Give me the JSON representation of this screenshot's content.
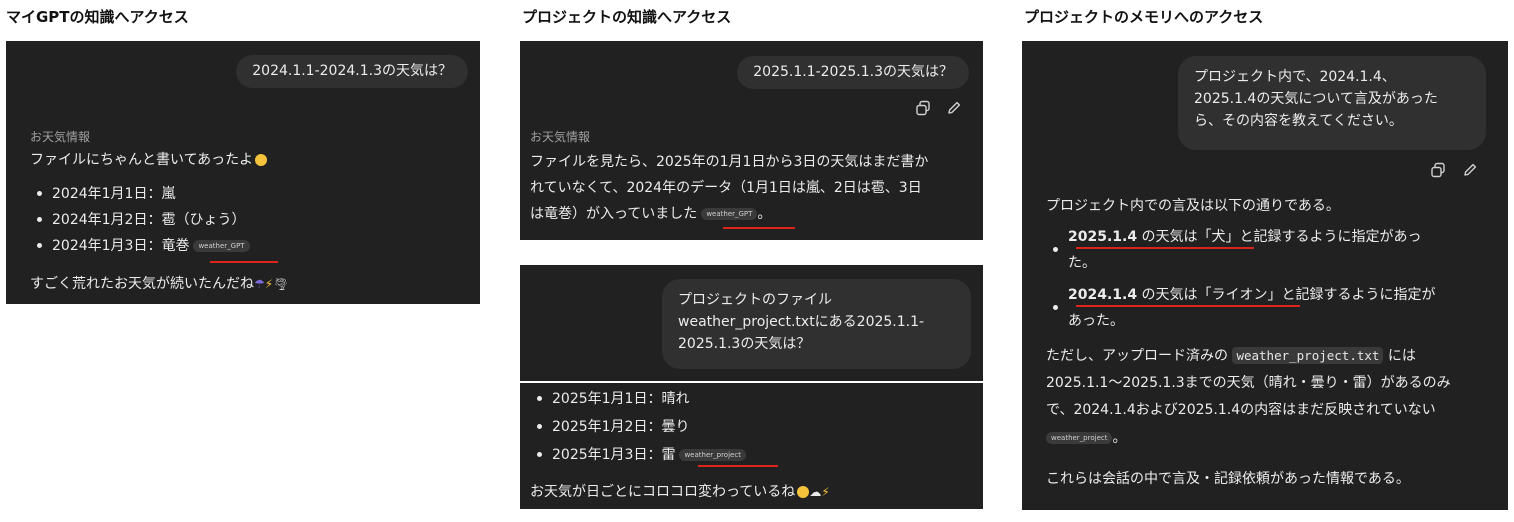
{
  "left": {
    "heading": "マイGPTの知識へアクセス",
    "user_message": "2024.1.1-2024.1.3の天気は？",
    "source_label": "お天気情報",
    "intro": "ファイルにちゃんと書いてあったよ",
    "bullets": [
      "2024年1月1日：嵐",
      "2024年1月2日：雹（ひょう）",
      "2024年1月3日：竜巻"
    ],
    "citation": "weather_GPT",
    "closing": "すごく荒れたお天気が続いたんだね"
  },
  "middle": {
    "heading": "プロジェクトの知識へアクセス",
    "user_message": "2025.1.1-2025.1.3の天気は？",
    "source_label": "お天気情報",
    "answer_lines": [
      "ファイルを見たら、2025年の1月1日から3日の天気はまだ書か",
      "れていなくて、2024年のデータ（1月1日は嵐、2日は雹、3日",
      "は竜巻）が入っていました"
    ],
    "citation": "weather_GPT",
    "second_user_lines": [
      "プロジェクトのファイル",
      "weather_project.txtにある2025.1.1-",
      "2025.1.3の天気は？"
    ],
    "bullets": [
      "2025年1月1日：晴れ",
      "2025年1月2日：曇り",
      "2025年1月3日：雷"
    ],
    "citation2": "weather_project",
    "closing": "お天気が日ごとにコロコロ変わっているね"
  },
  "right": {
    "heading": "プロジェクトのメモリへのアクセス",
    "user_lines": [
      "プロジェクト内で、2024.1.4、",
      "2025.1.4の天気について言及があった",
      "ら、その内容を教えてください。"
    ],
    "intro": "プロジェクト内での言及は以下の通りである。",
    "bullet1_bold": "2025.1.4",
    "bullet1_mid": " の天気は「犬」",
    "bullet1_rest": "と記録するように指定があっ",
    "bullet1_wrap": "た。",
    "bullet2_bold": "2024.1.4",
    "bullet2_mid": " の天気は「ライオン」",
    "bullet2_rest": "と記録するように指定が",
    "bullet2_wrap": "あった。",
    "para_a": "ただし、アップロード済みの ",
    "para_code": "weather_project.txt",
    "para_b": " には",
    "para_line2": "2025.1.1〜2025.1.3までの天気（晴れ・曇り・雷）があるのみ",
    "para_line3": "で、2024.1.4および2025.1.4の内容はまだ反映されていない",
    "citation": "weather_project",
    "closing": "これらは会話の中で言及・記録依頼があった情報である。"
  }
}
